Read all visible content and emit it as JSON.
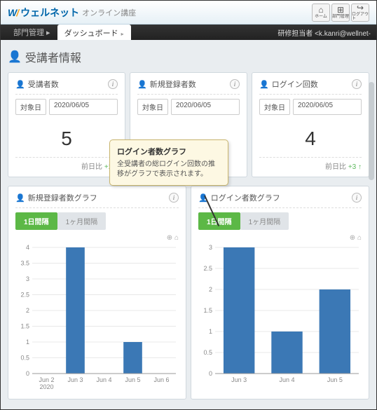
{
  "brand": {
    "name": "ウェルネット",
    "sub": "オンライン講座"
  },
  "top_buttons": [
    {
      "icon": "⌂",
      "label": "ホーム"
    },
    {
      "icon": "⊞",
      "label": "部門管理"
    },
    {
      "icon": "↪",
      "label": "ログアウト"
    }
  ],
  "nav": {
    "tab1": "部門管理 ▸",
    "tab2": "ダッシュボード",
    "right": "研修担当者 <k.kanri@wellnet-"
  },
  "page_title": "受講者情報",
  "cards": [
    {
      "title": "受講者数",
      "date_label": "対象日",
      "date": "2020/06/05",
      "value": "5",
      "foot_label": "前日比",
      "foot_delta": "+1 ↑"
    },
    {
      "title": "新規登録者数",
      "date_label": "対象日",
      "date": "2020/06/05",
      "value": "",
      "foot_label": "",
      "foot_delta": ""
    },
    {
      "title": "ログイン回数",
      "date_label": "対象日",
      "date": "2020/06/05",
      "value": "4",
      "foot_label": "前日比",
      "foot_delta": "+3 ↑"
    }
  ],
  "tooltip": {
    "title": "ログイン者数グラフ",
    "body": "全受講者の総ログイン回数の推移がグラフで表示されます。"
  },
  "chart_titles": [
    "新規登録者数グラフ",
    "ログイン者数グラフ"
  ],
  "chart_tab_active": "1日間隔",
  "chart_tab_inactive": "1ヶ月間隔",
  "chart_data": [
    {
      "type": "bar",
      "title": "新規登録者数グラフ",
      "categories": [
        "Jun 2 2020",
        "Jun 3",
        "Jun 4",
        "Jun 5",
        "Jun 6"
      ],
      "values": [
        null,
        4,
        null,
        1,
        null
      ],
      "ylim": [
        0,
        4
      ],
      "ystep": 0.5,
      "xlabel": "",
      "ylabel": ""
    },
    {
      "type": "bar",
      "title": "ログイン者数グラフ",
      "categories": [
        "Jun 3",
        "Jun 4",
        "Jun 5"
      ],
      "values": [
        3,
        1,
        2
      ],
      "ylim": [
        0,
        3
      ],
      "ystep": 0.5,
      "xlabel": "",
      "ylabel": ""
    }
  ]
}
